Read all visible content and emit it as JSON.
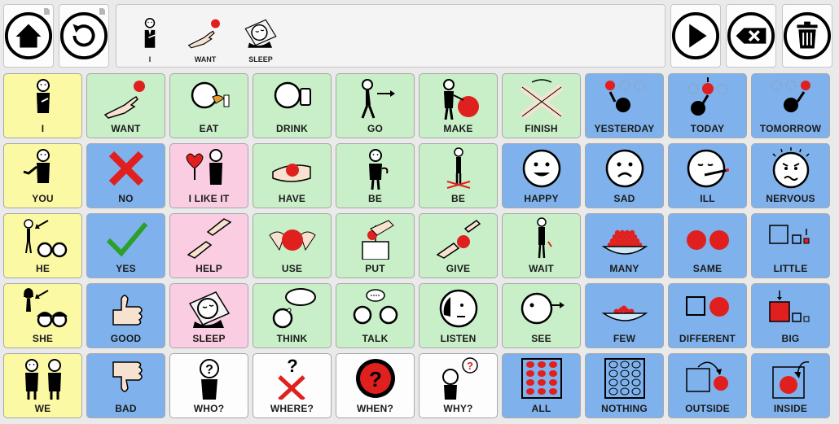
{
  "toolbar": {
    "home_icon": "home-icon",
    "back_icon": "back-arrow-icon",
    "speak_icon": "play-icon",
    "backspace_icon": "backspace-icon",
    "clear_icon": "trash-icon"
  },
  "sentence": {
    "words": [
      {
        "label": "I",
        "icon": "person-pointing-self-icon"
      },
      {
        "label": "WANT",
        "icon": "hand-reaching-ball-icon"
      },
      {
        "label": "SLEEP",
        "icon": "sleeping-face-icon"
      }
    ]
  },
  "colors": {
    "yellow": "#fbf9a3",
    "green": "#c8efc8",
    "blue": "#7fb1ec",
    "pink": "#fbcde2",
    "white": "#fdfdfd",
    "accent_red": "#e0201e"
  },
  "grid": {
    "rows": [
      [
        {
          "label": "I",
          "color": "yellow",
          "icon": "person-pointing-self-icon"
        },
        {
          "label": "WANT",
          "color": "green",
          "icon": "hand-reaching-ball-icon"
        },
        {
          "label": "EAT",
          "color": "green",
          "icon": "eating-icon"
        },
        {
          "label": "DRINK",
          "color": "green",
          "icon": "drinking-icon"
        },
        {
          "label": "GO",
          "color": "green",
          "icon": "walking-person-icon"
        },
        {
          "label": "MAKE",
          "color": "green",
          "icon": "person-making-icon"
        },
        {
          "label": "FINISH",
          "color": "green",
          "icon": "crossed-arms-icon"
        },
        {
          "label": "YESTERDAY",
          "color": "blue",
          "icon": "yesterday-icon"
        },
        {
          "label": "TODAY",
          "color": "blue",
          "icon": "today-icon"
        },
        {
          "label": "TOMORROW",
          "color": "blue",
          "icon": "tomorrow-icon"
        }
      ],
      [
        {
          "label": "YOU",
          "color": "yellow",
          "icon": "person-pointing-you-icon"
        },
        {
          "label": "NO",
          "color": "blue",
          "icon": "red-cross-icon"
        },
        {
          "label": "I LIKE IT",
          "color": "pink",
          "icon": "heart-person-icon"
        },
        {
          "label": "HAVE",
          "color": "green",
          "icon": "hand-holding-ball-icon"
        },
        {
          "label": "BE",
          "color": "green",
          "icon": "standing-person-icon"
        },
        {
          "label": "BE",
          "color": "green",
          "icon": "person-on-spot-icon"
        },
        {
          "label": "HAPPY",
          "color": "blue",
          "icon": "happy-face-icon"
        },
        {
          "label": "SAD",
          "color": "blue",
          "icon": "sad-face-icon"
        },
        {
          "label": "ILL",
          "color": "blue",
          "icon": "ill-face-icon"
        },
        {
          "label": "NERVOUS",
          "color": "blue",
          "icon": "nervous-face-icon"
        }
      ],
      [
        {
          "label": "HE",
          "color": "yellow",
          "icon": "he-icon"
        },
        {
          "label": "YES",
          "color": "blue",
          "icon": "green-check-icon"
        },
        {
          "label": "HELP",
          "color": "pink",
          "icon": "helping-hands-icon"
        },
        {
          "label": "USE",
          "color": "green",
          "icon": "hands-using-ball-icon"
        },
        {
          "label": "PUT",
          "color": "green",
          "icon": "put-in-box-icon"
        },
        {
          "label": "GIVE",
          "color": "green",
          "icon": "giving-hands-icon"
        },
        {
          "label": "WAIT",
          "color": "green",
          "icon": "waiting-person-icon"
        },
        {
          "label": "MANY",
          "color": "blue",
          "icon": "bowl-full-icon"
        },
        {
          "label": "SAME",
          "color": "blue",
          "icon": "two-balls-icon"
        },
        {
          "label": "LITTLE",
          "color": "blue",
          "icon": "little-squares-icon"
        }
      ],
      [
        {
          "label": "SHE",
          "color": "yellow",
          "icon": "she-icon"
        },
        {
          "label": "GOOD",
          "color": "blue",
          "icon": "thumbs-up-icon"
        },
        {
          "label": "SLEEP",
          "color": "pink",
          "icon": "sleeping-face-icon"
        },
        {
          "label": "THINK",
          "color": "green",
          "icon": "thinking-icon"
        },
        {
          "label": "TALK",
          "color": "green",
          "icon": "talking-icon"
        },
        {
          "label": "LISTEN",
          "color": "green",
          "icon": "listening-icon"
        },
        {
          "label": "SEE",
          "color": "green",
          "icon": "seeing-icon"
        },
        {
          "label": "FEW",
          "color": "blue",
          "icon": "bowl-few-icon"
        },
        {
          "label": "DIFFERENT",
          "color": "blue",
          "icon": "square-and-ball-icon"
        },
        {
          "label": "BIG",
          "color": "blue",
          "icon": "big-square-icon"
        }
      ],
      [
        {
          "label": "WE",
          "color": "yellow",
          "icon": "we-icon"
        },
        {
          "label": "BAD",
          "color": "blue",
          "icon": "thumbs-down-icon"
        },
        {
          "label": "WHO?",
          "color": "white",
          "icon": "who-icon"
        },
        {
          "label": "WHERE?",
          "color": "white",
          "icon": "where-icon"
        },
        {
          "label": "WHEN?",
          "color": "white",
          "icon": "when-clock-icon"
        },
        {
          "label": "WHY?",
          "color": "white",
          "icon": "why-icon"
        },
        {
          "label": "ALL",
          "color": "blue",
          "icon": "all-dots-icon"
        },
        {
          "label": "NOTHING",
          "color": "blue",
          "icon": "empty-dots-icon"
        },
        {
          "label": "OUTSIDE",
          "color": "blue",
          "icon": "outside-icon"
        },
        {
          "label": "INSIDE",
          "color": "blue",
          "icon": "inside-icon"
        }
      ]
    ]
  }
}
